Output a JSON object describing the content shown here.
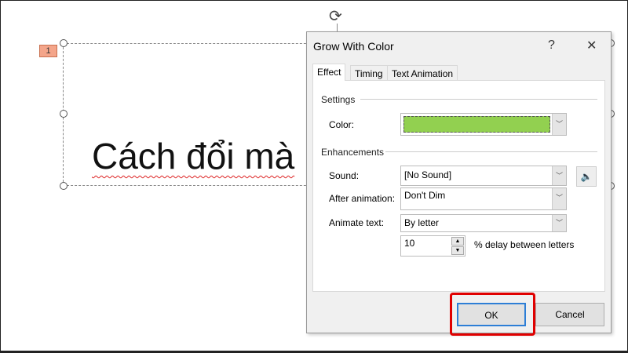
{
  "slide": {
    "number": "1",
    "text": "Cách đổi mà"
  },
  "dialog": {
    "title": "Grow With Color",
    "help": "?",
    "close": "✕",
    "tabs": [
      "Effect",
      "Timing",
      "Text Animation"
    ],
    "settings_label": "Settings",
    "color_label": "Color:",
    "color_value": "#92d050",
    "enhancements_label": "Enhancements",
    "sound_label": "Sound:",
    "sound_value": "[No Sound]",
    "after_label": "After animation:",
    "after_value": "Don't Dim",
    "animate_label": "Animate text:",
    "animate_value": "By letter",
    "delay_value": "10",
    "delay_label": "% delay between letters",
    "ok": "OK",
    "cancel": "Cancel"
  },
  "highlight_color": "#e00000"
}
